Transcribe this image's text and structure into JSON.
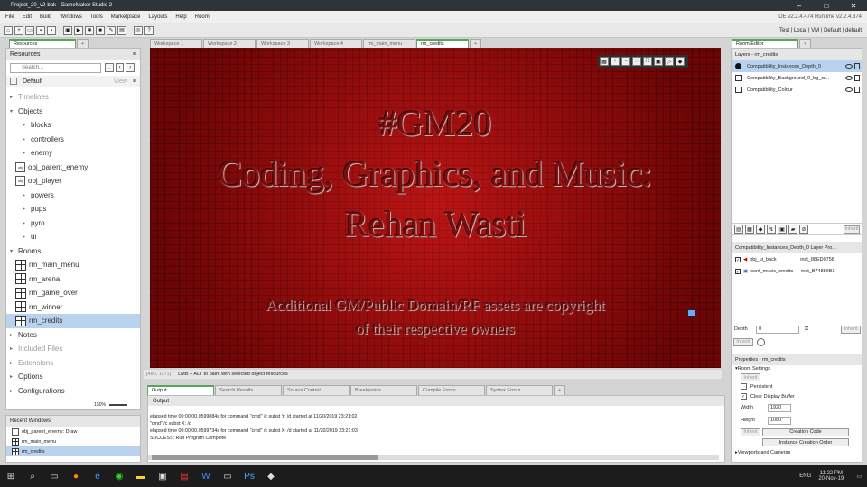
{
  "window": {
    "title": "Project_20_v2-bak - GameMaker Studio 2"
  },
  "menu": {
    "items": [
      "File",
      "Edit",
      "Build",
      "Windows",
      "Tools",
      "Marketplace",
      "Layouts",
      "Help",
      "Room"
    ],
    "right": "IDE v2.2.4.474  Runtime v2.2.4.374"
  },
  "toolbar": {
    "config": "Test | Local | VM | Default | default"
  },
  "resources": {
    "tab": "Resources",
    "header": "Resources",
    "search_placeholder": "Search...",
    "filter_label": "Default",
    "view_label": "View",
    "tree": [
      {
        "label": "Timelines",
        "kind": "group",
        "dim": true
      },
      {
        "label": "Objects",
        "kind": "group"
      },
      {
        "label": "blocks",
        "kind": "folder"
      },
      {
        "label": "controllers",
        "kind": "folder"
      },
      {
        "label": "enemy",
        "kind": "folder"
      },
      {
        "label": "obj_parent_enemy",
        "kind": "object"
      },
      {
        "label": "obj_player",
        "kind": "object"
      },
      {
        "label": "powers",
        "kind": "folder"
      },
      {
        "label": "pups",
        "kind": "folder"
      },
      {
        "label": "pyro",
        "kind": "folder"
      },
      {
        "label": "ui",
        "kind": "folder"
      },
      {
        "label": "Rooms",
        "kind": "group"
      },
      {
        "label": "rm_main_menu",
        "kind": "room"
      },
      {
        "label": "rm_arena",
        "kind": "room"
      },
      {
        "label": "rm_game_over",
        "kind": "room"
      },
      {
        "label": "rm_winner",
        "kind": "room"
      },
      {
        "label": "rm_credits",
        "kind": "room",
        "selected": true
      },
      {
        "label": "Notes",
        "kind": "group"
      },
      {
        "label": "Included Files",
        "kind": "group",
        "dim": true
      },
      {
        "label": "Extensions",
        "kind": "group",
        "dim": true
      },
      {
        "label": "Options",
        "kind": "group"
      },
      {
        "label": "Configurations",
        "kind": "group"
      }
    ],
    "zoom": "150%"
  },
  "recent": {
    "title": "Recent Windows",
    "items": [
      "obj_parent_enemy: Draw",
      "rm_main_menu",
      "rm_credits"
    ]
  },
  "workspace_tabs": [
    "Workspace 1",
    "Workspace 2",
    "Workspace 3",
    "Workspace 4",
    "rm_main_menu",
    "rm_credits"
  ],
  "room": {
    "line1": "#GM20",
    "line2": "Coding, Graphics, and Music:",
    "line3": "Rehan Wasti",
    "note1": "Additional GM/Public Domain/RF assets are copyright",
    "note2": "of their respective owners"
  },
  "status": {
    "coords": "[480, 1171]",
    "hint": "LMB + ALT to paint with selected object resources"
  },
  "output": {
    "tabs": [
      "Output",
      "Search Results",
      "Source Control",
      "Breakpoints",
      "Compile Errors",
      "Syntax Errors"
    ],
    "header": "Output",
    "lines": [
      "elapsed time 00:00:00.0599084s for command \"cmd\" /c subst Y: /d started at 11/20/2019 23:21:02",
      "\"cmd\" /c subst X: /d",
      "elapsed time 00:00:00.0599734s for command \"cmd\" /c subst X: /d started at 11/20/2019 23:21:03",
      "SUCCESS: Run Program Complete"
    ]
  },
  "room_editor": {
    "tab": "Room Editor",
    "layers_title": "Layers - rm_credits",
    "layers": [
      "Compatibility_Instances_Depth_0",
      "Compatibility_Background_0_bg_cr...",
      "Compatibility_Colour"
    ],
    "inherit": "Inherit",
    "layer_props_title": "Compatibility_Instances_Depth_0 Layer Pro...",
    "instances": [
      {
        "name": "obj_ui_back",
        "id": "inst_88ED0758"
      },
      {
        "name": "cont_music_credits",
        "id": "inst_B74886B3"
      }
    ],
    "depth_label": "Depth",
    "depth_value": "0",
    "props_title": "Properties - rm_credits",
    "room_settings": "Room Settings",
    "persistent": "Persistent",
    "clear_display": "Clear Display Buffer",
    "width_label": "Width",
    "width_value": "1920",
    "height_label": "Height",
    "height_value": "1080",
    "creation_code": "Creation Code",
    "instance_order": "Instance Creation Order",
    "viewports": "Viewports and Cameras"
  },
  "taskbar": {
    "time": "11:22 PM",
    "date": "20-Nov-19",
    "lang": "ENG"
  }
}
